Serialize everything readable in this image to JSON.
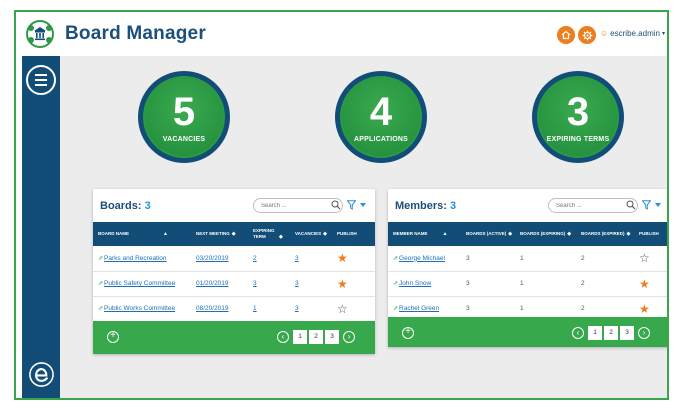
{
  "header": {
    "app_title": "Board Manager",
    "home_icon": "home-icon",
    "settings_icon": "gear-icon",
    "user": "escribe.admin",
    "user_icon": "user-icon",
    "accent": "#ee7d1e",
    "brand": "#1c4f7a"
  },
  "sidebar": {
    "menu_icon": "hamburger-menu-icon",
    "brand_icon": "escribe-e-logo"
  },
  "kpis": [
    {
      "value": "5",
      "label": "VACANCIES"
    },
    {
      "value": "4",
      "label": "APPLICATIONS"
    },
    {
      "value": "3",
      "label": "EXPIRING TERMS"
    }
  ],
  "boards": {
    "title": "Boards:",
    "count": "3",
    "search_placeholder": "Search ...",
    "columns": [
      "BOARD NAME",
      "NEXT MEETING",
      "EXPIRING TERM",
      "VACANCIES",
      "PUBLISH"
    ],
    "rows": [
      {
        "name": "Parks and Recreation",
        "next_meeting": "03/20/2019",
        "expiring_term": "2",
        "vacancies": "3",
        "published": true
      },
      {
        "name": "Public Safety Committee",
        "next_meeting": "01/20/2019",
        "expiring_term": "3",
        "vacancies": "3",
        "published": true
      },
      {
        "name": "Public Works Committee",
        "next_meeting": "08/20/2019",
        "expiring_term": "1",
        "vacancies": "3",
        "published": false
      }
    ],
    "pages": [
      "1",
      "2",
      "3"
    ]
  },
  "members": {
    "title": "Members:",
    "count": "3",
    "search_placeholder": "Search ...",
    "columns": [
      "MEMBER NAME",
      "BOARDS (ACTIVE)",
      "BOARDS (EXPIRING)",
      "BOARDS (EXPIRED)",
      "PUBLISH"
    ],
    "rows": [
      {
        "name": "George Michael",
        "active": "3",
        "expiring": "1",
        "expired": "2",
        "published": false
      },
      {
        "name": "John Snow",
        "active": "3",
        "expiring": "1",
        "expired": "2",
        "published": true
      },
      {
        "name": "Rachel Green",
        "active": "3",
        "expiring": "1",
        "expired": "2",
        "published": true
      }
    ],
    "pages": [
      "1",
      "2",
      "3"
    ]
  }
}
